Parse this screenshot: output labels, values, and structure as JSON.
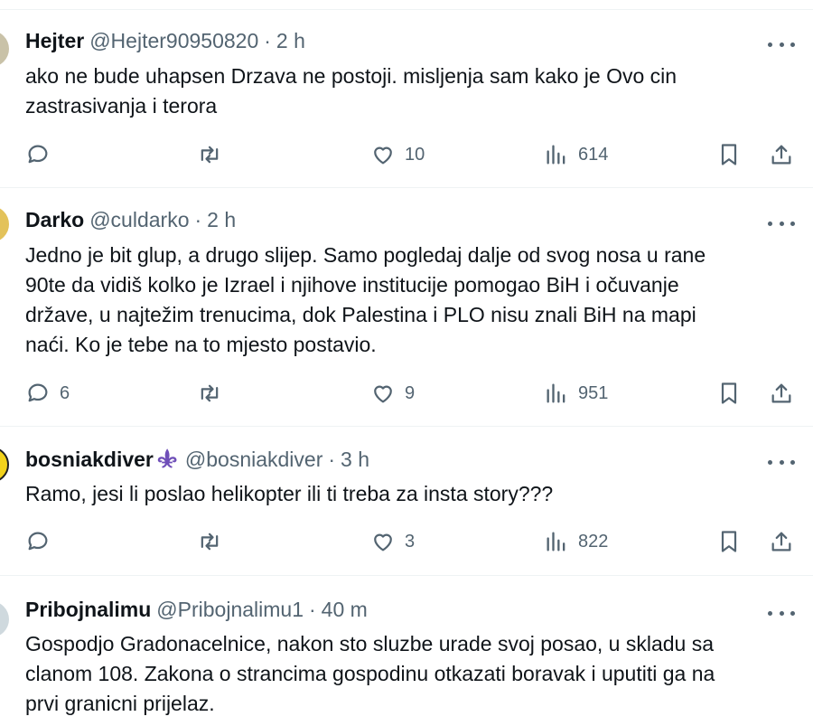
{
  "tweets": [
    {
      "name": "Hejter",
      "handle": "@Hejter90950820",
      "time": "2 h",
      "lines": [
        "ako ne bude uhapsen Drzava ne postoji. misljenja sam kako je  Ovo  cin",
        "zastrasivanja i terora"
      ],
      "replies": "",
      "retweets": "",
      "likes": "10",
      "views": "614"
    },
    {
      "name": "Darko",
      "handle": "@culdarko",
      "time": "2 h",
      "lines": [
        "Jedno je bit glup, a drugo slijep. Samo pogledaj dalje od svog nosa u rane",
        "90te da vidiš kolko je Izrael i njihove institucije pomogao BiH i očuvanje",
        "države, u najtežim trenucima, dok Palestina i PLO nisu znali BiH na mapi",
        "naći. Ko je tebe na to mjesto postavio."
      ],
      "replies": "6",
      "retweets": "",
      "likes": "9",
      "views": "951"
    },
    {
      "name": "bosniakdiver",
      "handle": "@bosniakdiver",
      "time": "3 h",
      "lines": [
        "Ramo, jesi li poslao helikopter ili ti treba za insta story???"
      ],
      "replies": "",
      "retweets": "",
      "likes": "3",
      "views": "822"
    },
    {
      "name": "Pribojnalimu",
      "handle": "@Pribojnalimu1",
      "time": "40 m",
      "lines": [
        "Gospodjo Gradonacelnice, nakon sto sluzbe urade svoj posao, u skladu sa",
        "clanom 108. Zakona o strancima gospodinu otkazati boravak i uputiti ga na",
        "prvi granicni prijelaz."
      ]
    }
  ],
  "dot_separator": "·",
  "icons": [
    "reply-icon",
    "retweet-icon",
    "like-icon",
    "views-icon",
    "bookmark-icon",
    "share-icon",
    "more-icon",
    "fleur-de-lis-icon"
  ],
  "colors": {
    "text": "#0f1419",
    "secondary": "#536471",
    "divider": "#eff3f4",
    "fleur": "#6f4fb8"
  }
}
